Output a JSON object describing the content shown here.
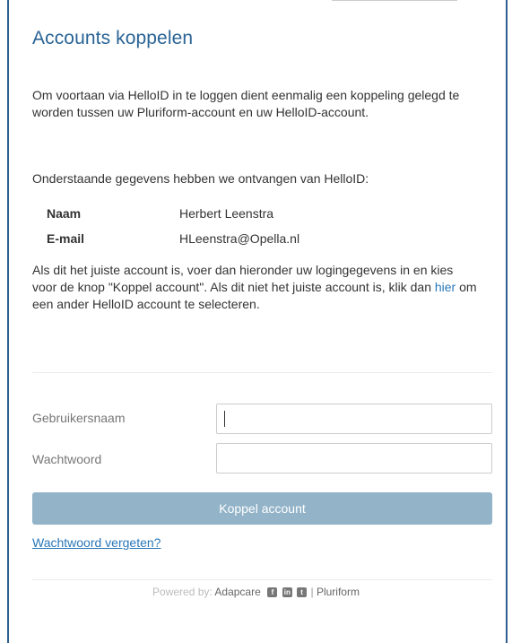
{
  "title": "Accounts koppelen",
  "intro": "Om voortaan via HelloID in te loggen dient eenmalig een koppeling gelegd te worden tussen uw Pluriform-account en uw HelloID-account.",
  "received_text": "Onderstaande gegevens hebben we ontvangen van HelloID:",
  "info": {
    "name_label": "Naam",
    "name_value": "Herbert Leenstra",
    "email_label": "E-mail",
    "email_value": "HLeenstra@Opella.nl"
  },
  "check": {
    "before_link": "Als dit het juiste account is, voer dan hieronder uw logingegevens in en kies voor de knop \"Koppel account\". Als dit niet het juiste account is, klik dan ",
    "link_text": "hier",
    "after_link": " om een ander HelloID account te selecteren."
  },
  "form": {
    "username_label": "Gebruikersnaam",
    "username_value": "",
    "password_label": "Wachtwoord",
    "password_value": "",
    "submit_label": "Koppel account",
    "forgot_label": "Wachtwoord vergeten?"
  },
  "footer": {
    "powered_by": "Powered by:",
    "brand": "Adapcare",
    "separator": "|",
    "partner": "Pluriform",
    "social_icons": [
      "facebook-icon",
      "linkedin-icon",
      "twitter-icon"
    ]
  },
  "colors": {
    "accent": "#2a6496",
    "link": "#2a77b8",
    "button": "#92b3c8",
    "frame": "#2f5f8f"
  }
}
